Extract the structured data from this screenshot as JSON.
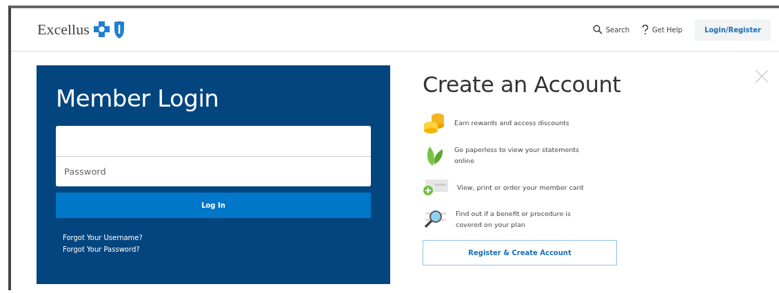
{
  "header": {
    "logo": "Excellus",
    "nav": [
      {
        "kind": "search",
        "label": "Search"
      },
      {
        "kind": "help",
        "label": "Get Help"
      }
    ],
    "account_button": "Login/Register"
  },
  "login": {
    "title": "Member Login",
    "password_placeholder": "Password",
    "button": "Log In",
    "links": [
      "Forgot Your Username?",
      "Forgot Your Password?"
    ]
  },
  "register": {
    "title": "Create an Account",
    "benefits": [
      {
        "kind": "coins",
        "text": "Earn rewards and access discounts"
      },
      {
        "kind": "leaf",
        "text": "Go paperless to view your statements online"
      },
      {
        "kind": "card",
        "text": "View, print or order your member card"
      },
      {
        "kind": "magnifier",
        "text": "Find out if a benefit or procedure is covered on your plan"
      }
    ],
    "button": "Register & Create Account"
  }
}
